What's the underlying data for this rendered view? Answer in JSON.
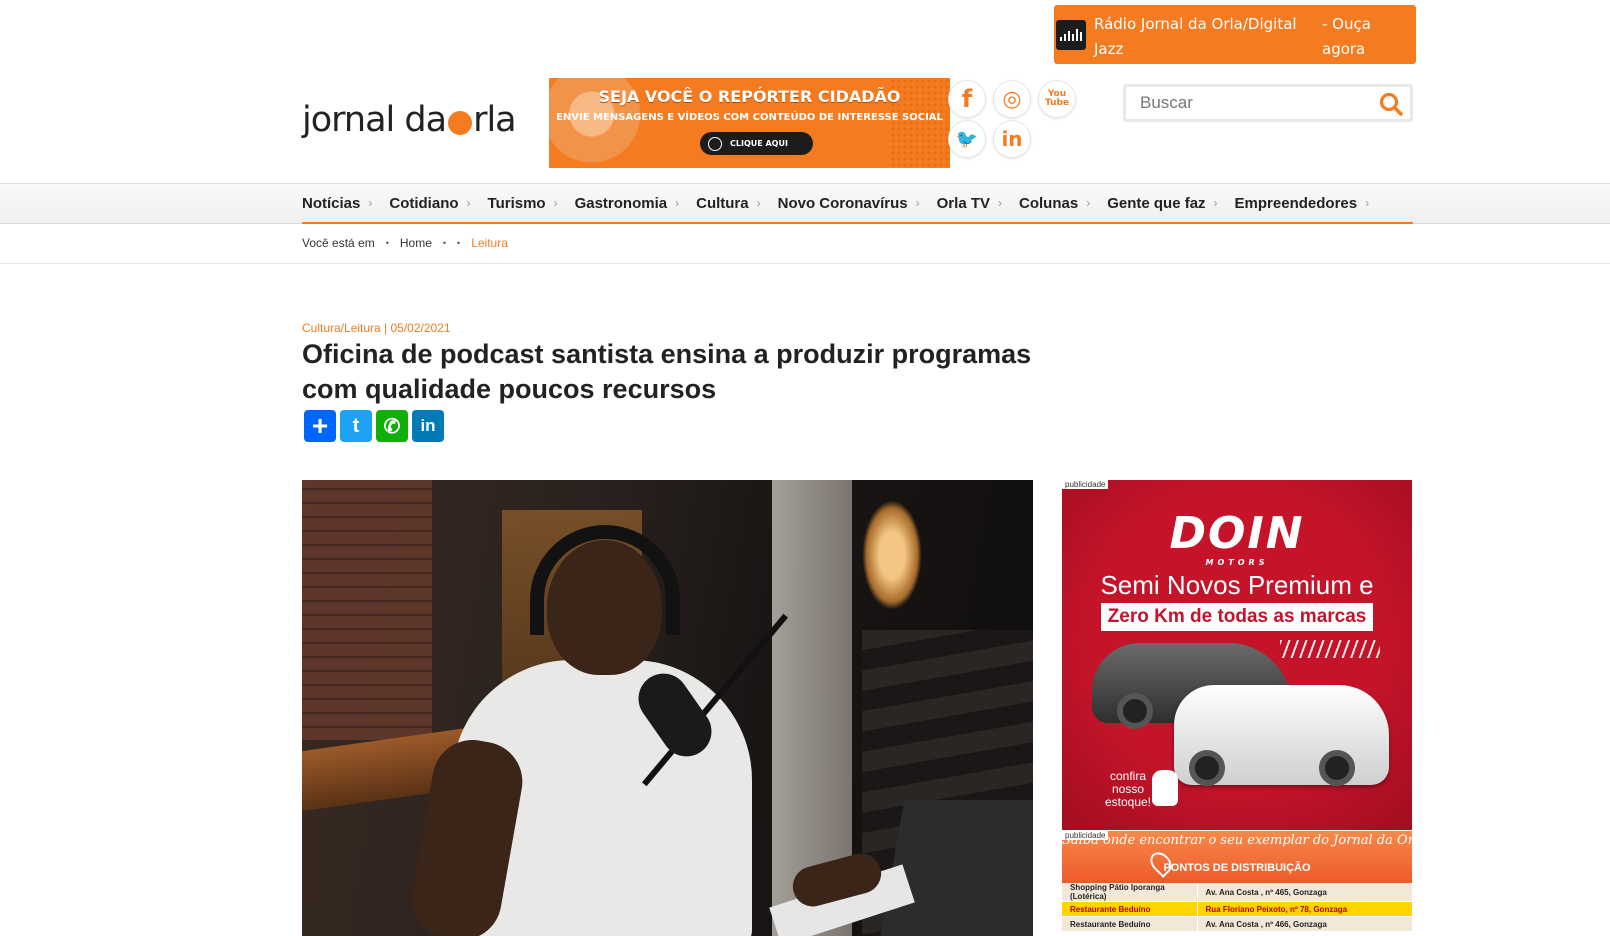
{
  "radio": {
    "title": "Rádio Jornal da Orla/Digital Jazz",
    "cta": "- Ouça agora"
  },
  "logo": {
    "part1": "jornal da ",
    "part2": "rla"
  },
  "banner": {
    "headline": "SEJA VOCÊ O REPÓRTER CIDADÃO",
    "subline": "ENVIE MENSAGENS E VÍDEOS COM CONTEÚDO DE INTERESSE SOCIAL",
    "button": "CLIQUE AQUI"
  },
  "social": [
    {
      "name": "facebook",
      "glyph": "f"
    },
    {
      "name": "instagram",
      "glyph": "◎"
    },
    {
      "name": "youtube",
      "glyph": "You Tube"
    },
    {
      "name": "twitter",
      "glyph": "🐦"
    },
    {
      "name": "linkedin",
      "glyph": "in"
    }
  ],
  "search": {
    "placeholder": "Buscar"
  },
  "nav": {
    "items": [
      "Notícias",
      "Cotidiano",
      "Turismo",
      "Gastronomia",
      "Cultura",
      "Novo Coronavírus",
      "Orla TV",
      "Colunas",
      "Gente que faz",
      "Empreendedores"
    ]
  },
  "breadcrumb": {
    "label": "Você está em",
    "home": "Home",
    "current": "Leitura"
  },
  "article": {
    "meta": "Cultura/Leitura | 05/02/2021",
    "title": "Oficina de podcast santista ensina a produzir programas com qualidade poucos recursos"
  },
  "share": [
    {
      "name": "share",
      "glyph": "+",
      "color": "#0166ff"
    },
    {
      "name": "twitter",
      "glyph": "t",
      "color": "#1da1f2"
    },
    {
      "name": "whatsapp",
      "glyph": "✆",
      "color": "#12af0a"
    },
    {
      "name": "linkedin",
      "glyph": "in",
      "color": "#007bb5"
    }
  ],
  "ads": {
    "label": "publicidade",
    "doin": {
      "brand": "DOIN",
      "brand_sub": "MOTORS",
      "line1": "Semi Novos Premium e",
      "line2": "Zero Km de todas as marcas",
      "cta": "confira nosso estoque!"
    },
    "distribution": {
      "header": "Saiba onde encontrar o seu exemplar do Jornal da Orla",
      "subheader": "PONTOS DE DISTRIBUIÇÃO",
      "rows": [
        [
          "Shopping Pátio Iporanga (Lotérica)",
          "Av. Ana Costa , nº 465, Gonzaga"
        ],
        [
          "Restaurante Beduíno",
          "Rua Floriano Peixoto, nº 78, Gonzaga"
        ],
        [
          "Restaurante Beduíno",
          "Av. Ana Costa , nº 466, Gonzaga"
        ]
      ]
    }
  }
}
